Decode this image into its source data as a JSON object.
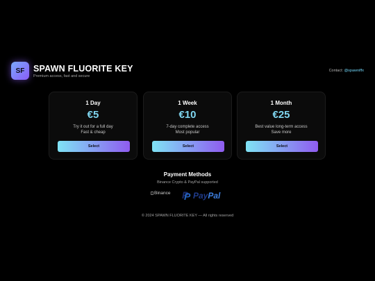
{
  "brand": {
    "logo_text": "SF",
    "title": "SPAWN FLUORITE KEY",
    "subtitle": "Premium access, fast and secure"
  },
  "contact": {
    "label": "Contact:",
    "handle": "@spawniffx"
  },
  "plans": [
    {
      "name": "1 Day",
      "price": "€5",
      "desc1": "Try it out for a full day",
      "desc2": "Fast & cheap",
      "button": "Select"
    },
    {
      "name": "1 Week",
      "price": "€10",
      "desc1": "7-day complete access",
      "desc2": "Most popular",
      "button": "Select"
    },
    {
      "name": "1 Month",
      "price": "€25",
      "desc1": "Best value long-term access",
      "desc2": "Save more",
      "button": "Select"
    }
  ],
  "payments": {
    "title": "Payment Methods",
    "subtitle": "Binance Crypto & PayPal supported",
    "binance_alt": "Binance",
    "paypal_part1": "Pay",
    "paypal_part2": "Pal",
    "paypal_mark": "P"
  },
  "footer": {
    "text": "© 2024 SPAWN FLUORITE KEY — All rights reserved"
  },
  "colors": {
    "background": "#000000",
    "accent_cyan": "#7fd6f0",
    "accent_purple": "#8f5cf0",
    "card_bg": "#0b0b0b"
  },
  "icons": {
    "logo": "sf-logo-icon",
    "binance": "binance-logo-broken-image",
    "paypal": "paypal-logo-icon"
  }
}
